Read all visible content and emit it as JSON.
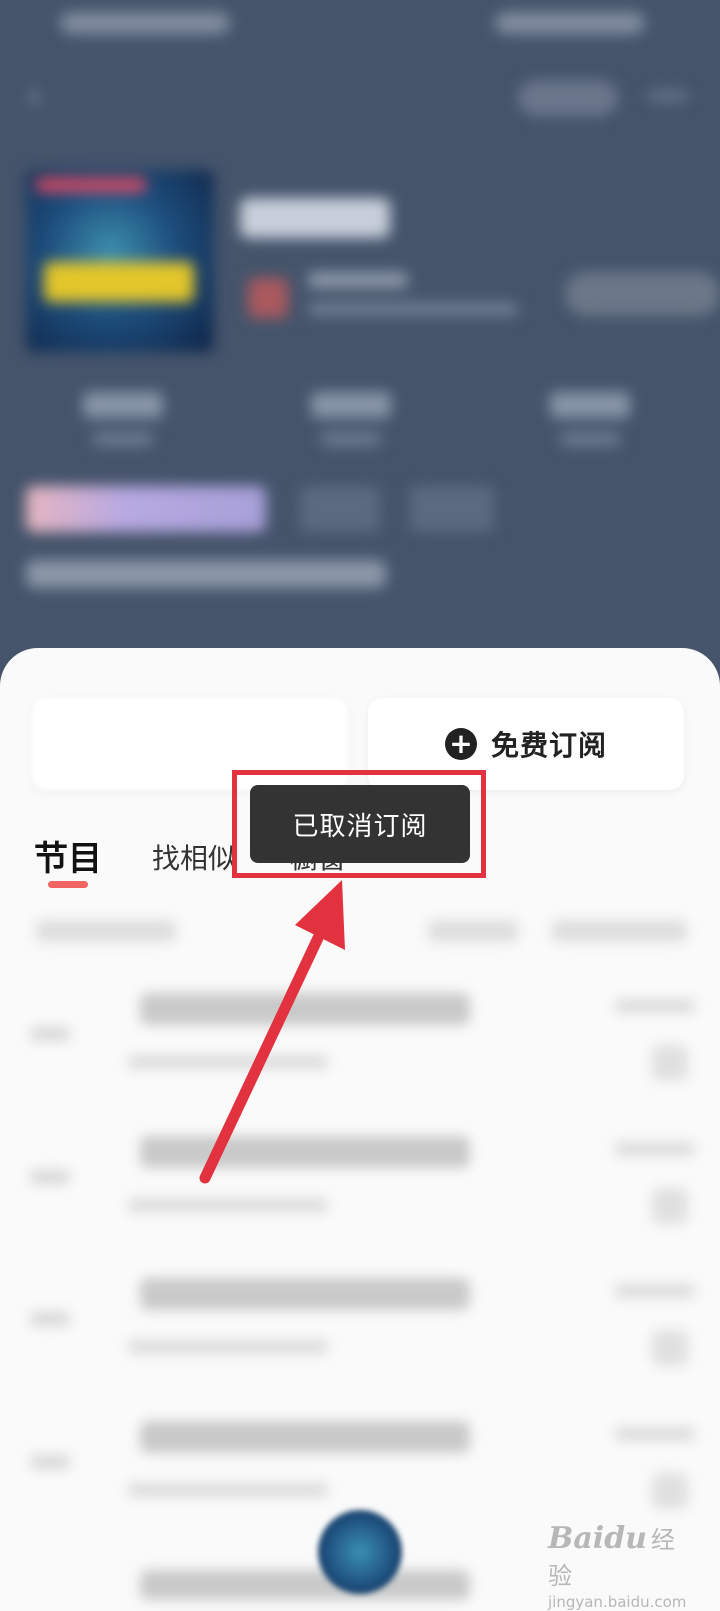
{
  "subscribe_card": {
    "label": "免费订阅",
    "icon": "plus-circle-icon"
  },
  "tabs": [
    {
      "label": "节目",
      "active": true
    },
    {
      "label": "找相似",
      "active": false
    },
    {
      "label": "橱窗",
      "active": false
    }
  ],
  "toast": {
    "message": "已取消订阅"
  },
  "annotation": {
    "frame_color": "#e3323f",
    "arrow_color": "#e3323f"
  },
  "colors": {
    "header_bg": "#45546b",
    "tab_underline": "#f06464",
    "toast_bg": "#333333"
  },
  "watermark": {
    "brand": "Bai",
    "brand_paw": "du",
    "brand_cn": "经验",
    "domain": "jingyan.baidu.com"
  }
}
